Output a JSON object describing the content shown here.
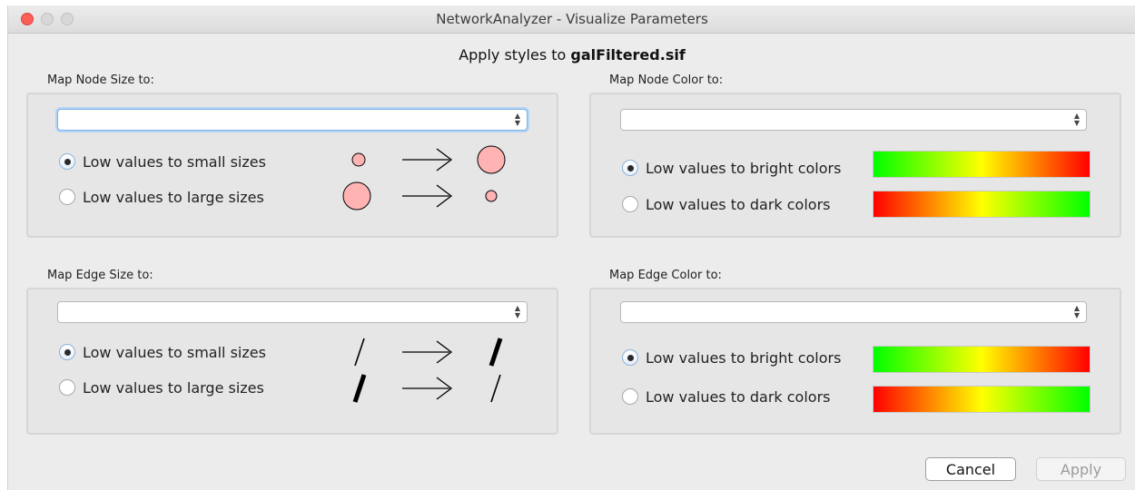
{
  "window": {
    "title": "NetworkAnalyzer - Visualize Parameters"
  },
  "header": {
    "prefix": "Apply styles to",
    "filename": "galFiltered.sif"
  },
  "node_size": {
    "label": "Map Node Size to:",
    "selected": "",
    "option_small": "Low values to small sizes",
    "option_large": "Low values to large sizes",
    "checked": "small"
  },
  "node_color": {
    "label": "Map Node Color to:",
    "selected": "",
    "option_bright": "Low values to bright colors",
    "option_dark": "Low values to dark colors",
    "checked": "bright"
  },
  "edge_size": {
    "label": "Map Edge Size to:",
    "selected": "",
    "option_small": "Low values to small sizes",
    "option_large": "Low values to large sizes",
    "checked": "small"
  },
  "edge_color": {
    "label": "Map Edge Color to:",
    "selected": "",
    "option_bright": "Low values to bright colors",
    "option_dark": "Low values to dark colors",
    "checked": "bright"
  },
  "footer": {
    "cancel_label": "Cancel",
    "apply_label": "Apply"
  },
  "colors": {
    "node_fill": "#ffb3b3",
    "gradient_low": "#00ff00",
    "gradient_mid": "#ffff00",
    "gradient_high": "#ff0000",
    "focus_ring": "#7fb2e5"
  }
}
